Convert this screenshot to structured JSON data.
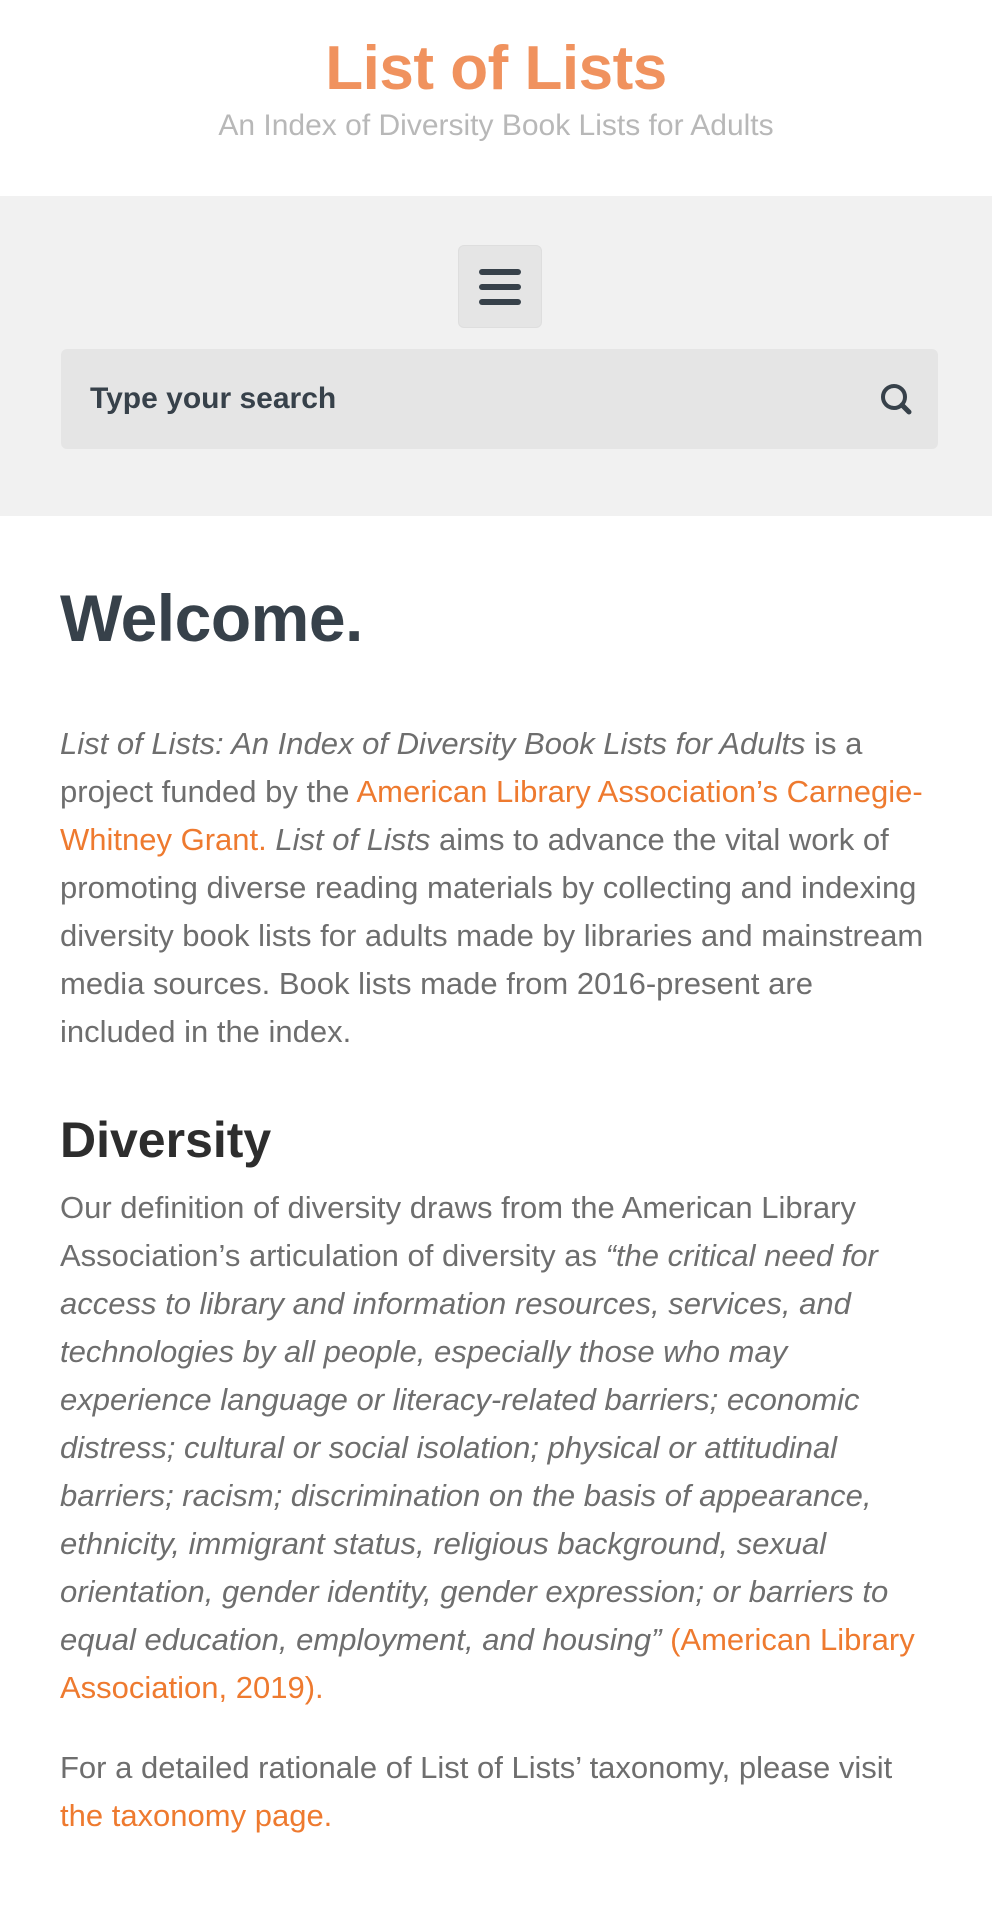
{
  "header": {
    "site_title": "List of Lists",
    "tagline": "An Index of Diversity Book Lists for Adults"
  },
  "nav": {
    "menu_icon": "hamburger-menu-icon",
    "search": {
      "placeholder": "Type your search",
      "value": "",
      "icon": "search-icon"
    }
  },
  "main": {
    "title": "Welcome.",
    "intro": {
      "project_title": "List of Lists: An Index of Diversity Book Lists for Adults",
      "text_1": " is a project funded by the ",
      "grant_link": "American Library Association’s Carnegie-Whitney Grant.",
      "text_2": " ",
      "short_title": "List of Lists",
      "text_3": " aims to advance the vital work of promoting diverse reading materials by collecting and indexing diversity book lists for adults made by libraries and mainstream media sources. Book lists made from 2016-present are included in the index."
    },
    "diversity": {
      "heading": "Diversity",
      "text_1": "Our definition of diversity draws from the American Library Association’s articulation of diversity as ",
      "quote": "“the critical need for access to library and information resources, services, and technologies by all people, especially those who may experience language or literacy-related barriers; economic distress; cultural or social isolation; physical or attitudinal barriers; racism; discrimination on the basis of appearance, ethnicity, immigrant status, religious background, sexual orientation, gender identity, gender expression; or barriers to equal education, employment, and housing”",
      "text_2": " ",
      "citation_link": "(American Library Association, 2019)."
    },
    "taxonomy": {
      "text": "For a detailed rationale of List of Lists’ taxonomy, please visit ",
      "link": "the taxonomy page."
    }
  },
  "colors": {
    "brand_orange": "#f0925e",
    "link_orange": "#ee7a2f",
    "heading_dark": "#37414a",
    "body_text": "#6e6e6e",
    "tagline_gray": "#b8b8b8",
    "nav_background": "#f1f1f1",
    "control_background": "#e5e5e5"
  }
}
